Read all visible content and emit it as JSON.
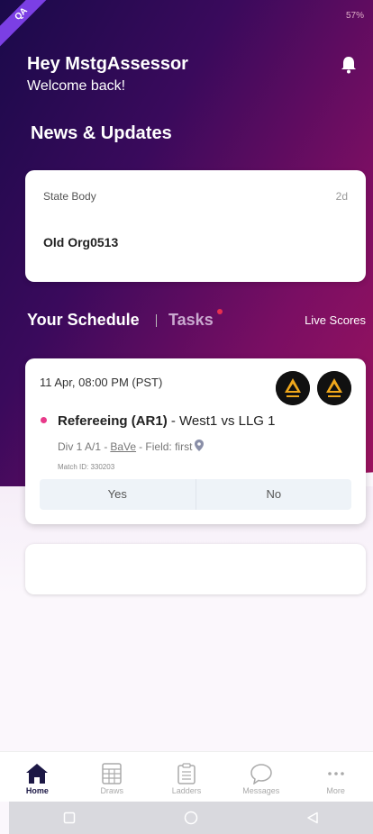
{
  "ribbon": "QA",
  "status": {
    "battery": "57%"
  },
  "header": {
    "greeting": "Hey MstgAssessor",
    "subtitle": "Welcome back!"
  },
  "news": {
    "title": "News & Updates",
    "items": [
      {
        "source": "State Body",
        "age": "2d",
        "text": "Old Org0513"
      }
    ]
  },
  "schedule_tabs": {
    "schedule": "Your Schedule",
    "tasks": "Tasks",
    "live_scores": "Live Scores"
  },
  "match": {
    "datetime": "11 Apr, 08:00 PM (PST)",
    "role": "Refereeing (AR1)",
    "teams": " - West1 vs LLG 1",
    "division": "Div 1 A/1 - ",
    "venue": "BaVe",
    "field": " - Field: first",
    "match_id": "Match ID: 330203",
    "yes_label": "Yes",
    "no_label": "No"
  },
  "bottom_nav": {
    "items": [
      {
        "label": "Home",
        "icon": "home-icon"
      },
      {
        "label": "Draws",
        "icon": "draws-icon"
      },
      {
        "label": "Ladders",
        "icon": "ladders-icon"
      },
      {
        "label": "Messages",
        "icon": "messages-icon"
      },
      {
        "label": "More",
        "icon": "more-icon"
      }
    ]
  },
  "colors": {
    "gradient_start": "#1a0a4a",
    "gradient_end": "#a0145e",
    "accent_dot": "#e83a8a",
    "nav_active": "#1c1845"
  }
}
